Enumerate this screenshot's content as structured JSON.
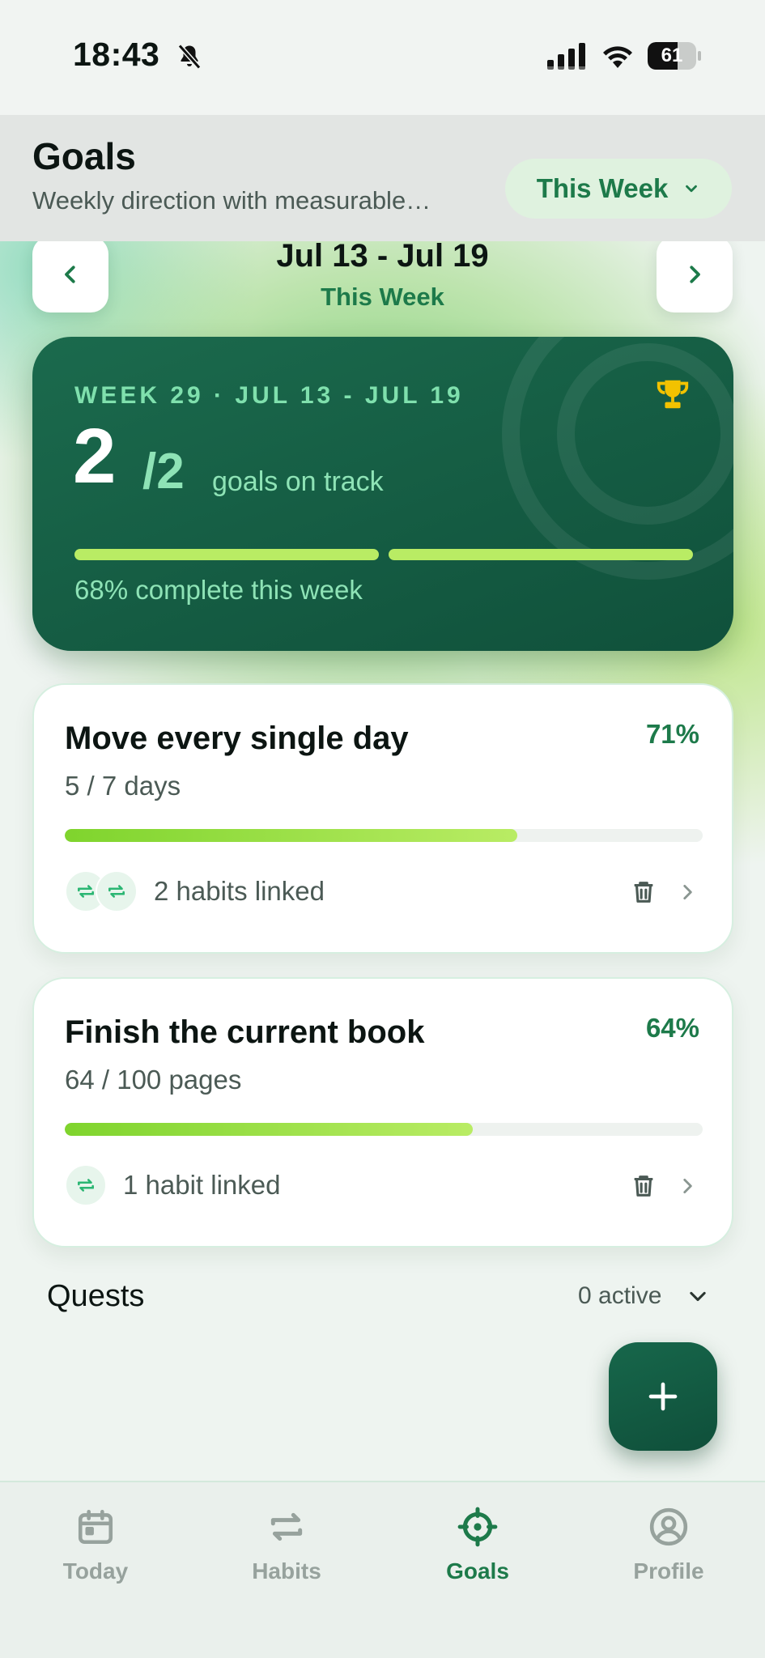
{
  "status_bar": {
    "time": "18:43",
    "battery": "61",
    "battery_level": 0.61
  },
  "header": {
    "title": "Goals",
    "subtitle": "Weekly direction with measurable…",
    "period_select": "This Week"
  },
  "week_nav": {
    "range": "Jul 13 - Jul 19",
    "label": "This Week"
  },
  "summary": {
    "week_label": "WEEK 29 · JUL 13 - JUL 19",
    "on_track": "2",
    "total": "/2",
    "on_track_label": "goals on track",
    "complete_text": "68% complete this week"
  },
  "goals": [
    {
      "title": "Move every single day",
      "percent": "71%",
      "progress": 0.71,
      "subtitle": "5 / 7 days",
      "linked": "2 habits linked"
    },
    {
      "title": "Finish the current book",
      "percent": "64%",
      "progress": 0.64,
      "subtitle": "64 / 100 pages",
      "linked": "1 habit linked"
    }
  ],
  "quests": {
    "title": "Quests",
    "count": "0 active"
  },
  "tabs": [
    {
      "label": "Today",
      "icon": "calendar-icon",
      "active": false
    },
    {
      "label": "Habits",
      "icon": "repeat-icon",
      "active": false
    },
    {
      "label": "Goals",
      "icon": "target-icon",
      "active": true
    },
    {
      "label": "Profile",
      "icon": "user-circle-icon",
      "active": false
    }
  ],
  "colors": {
    "accent": "#1d7a4a",
    "card_dark": "#10513b",
    "progress_lime": "#b9ec64",
    "trophy": "#f2c200"
  }
}
